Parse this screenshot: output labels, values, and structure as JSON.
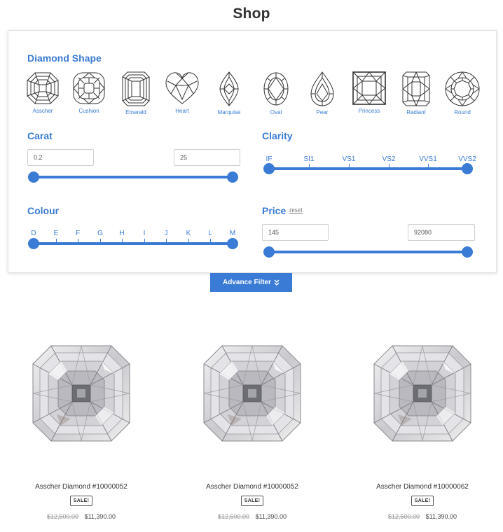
{
  "page": {
    "title": "Shop"
  },
  "filters": {
    "shape": {
      "title": "Diamond Shape",
      "items": [
        {
          "label": "Asscher",
          "icon": "asscher-shape-icon"
        },
        {
          "label": "Cushion",
          "icon": "cushion-shape-icon"
        },
        {
          "label": "Emerald",
          "icon": "emerald-shape-icon"
        },
        {
          "label": "Heart",
          "icon": "heart-shape-icon"
        },
        {
          "label": "Marquise",
          "icon": "marquise-shape-icon"
        },
        {
          "label": "Oval",
          "icon": "oval-shape-icon"
        },
        {
          "label": "Pear",
          "icon": "pear-shape-icon"
        },
        {
          "label": "Princess",
          "icon": "princess-shape-icon"
        },
        {
          "label": "Radiant",
          "icon": "radiant-shape-icon"
        },
        {
          "label": "Round",
          "icon": "round-shape-icon"
        }
      ]
    },
    "carat": {
      "title": "Carat",
      "min": "0.2",
      "max": "25"
    },
    "clarity": {
      "title": "Clarity",
      "grades": [
        "IF",
        "SI1",
        "VS1",
        "VS2",
        "VVS1",
        "VVS2"
      ]
    },
    "colour": {
      "title": "Colour",
      "grades": [
        "D",
        "E",
        "F",
        "G",
        "H",
        "I",
        "J",
        "K",
        "L",
        "M"
      ]
    },
    "price": {
      "title": "Price",
      "reset": "reset",
      "min": "145",
      "max": "92080"
    },
    "advance_button": "Advance Filter"
  },
  "products": [
    {
      "name": "Asscher Diamond #10000052",
      "badge": "SALE!",
      "old_price": "$12,500.00",
      "price": "$11,390.00"
    },
    {
      "name": "Asscher Diamond #10000052",
      "badge": "SALE!",
      "old_price": "$12,500.00",
      "price": "$11,390.00"
    },
    {
      "name": "Asscher Diamond #10000062",
      "badge": "SALE!",
      "old_price": "$12,500.00",
      "price": "$11,390.00"
    }
  ],
  "colors": {
    "accent": "#3a7bd5",
    "text": "#333333",
    "muted": "#999999"
  }
}
